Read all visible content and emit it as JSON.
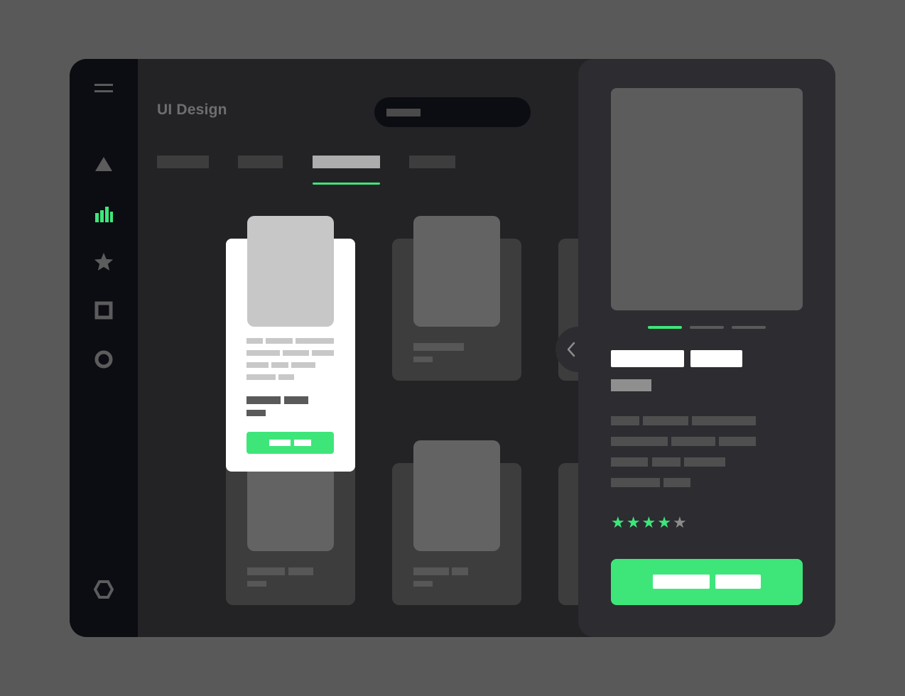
{
  "header": {
    "title": "UI Design"
  },
  "search": {
    "placeholder": ""
  },
  "tabs": [
    {
      "label": "",
      "active": false
    },
    {
      "label": "",
      "active": false
    },
    {
      "label": "",
      "active": true
    },
    {
      "label": "",
      "active": false
    }
  ],
  "sidebar": {
    "icons": [
      "menu-icon",
      "triangle-icon",
      "bar-chart-icon",
      "star-icon",
      "square-icon",
      "circle-icon",
      "hexagon-icon"
    ],
    "active_icon": "bar-chart-icon"
  },
  "detail": {
    "rating": 4,
    "rating_max": 5,
    "carousel_active": 0,
    "carousel_count": 3
  },
  "colors": {
    "accent": "#3ee67a",
    "background": "#595959",
    "panel": "#232326",
    "sidebar": "#0b0d13",
    "detail_panel": "#2c2c31"
  }
}
